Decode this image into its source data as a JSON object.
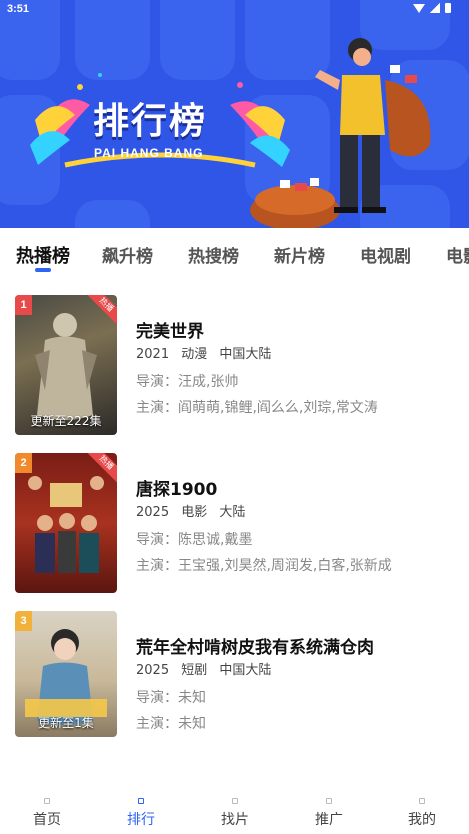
{
  "status_bar": {
    "time": "3:51"
  },
  "banner": {
    "title": "排行榜",
    "subtitle": "PAI HANG BANG"
  },
  "tabs": [
    {
      "label": "热播榜",
      "active": true
    },
    {
      "label": "飙升榜",
      "active": false
    },
    {
      "label": "热搜榜",
      "active": false
    },
    {
      "label": "新片榜",
      "active": false
    },
    {
      "label": "电视剧",
      "active": false
    },
    {
      "label": "电影",
      "active": false
    }
  ],
  "items": [
    {
      "rank": "1",
      "rank_color": "#e84a4a",
      "hot_badge": "热播",
      "update": "更新至222集",
      "title": "完美世界",
      "year": "2021",
      "genre": "动漫",
      "region": "中国大陆",
      "director": "导演：汪成,张帅",
      "cast": "主演：阎萌萌,锦鲤,阎么么,刘琮,常文涛"
    },
    {
      "rank": "2",
      "rank_color": "#f08a2c",
      "hot_badge": "热播",
      "update": "",
      "title": "唐探1900",
      "year": "2025",
      "genre": "电影",
      "region": "大陆",
      "director": "导演：陈思诚,戴墨",
      "cast": "主演：王宝强,刘昊然,周润发,白客,张新成"
    },
    {
      "rank": "3",
      "rank_color": "#f2b23a",
      "hot_badge": "",
      "update": "更新至1集",
      "title": "荒年全村啃树皮我有系统满仓肉",
      "year": "2025",
      "genre": "短剧",
      "region": "中国大陆",
      "director": "导演：未知",
      "cast": "主演：未知"
    }
  ],
  "bottom_nav": [
    {
      "label": "首页",
      "icon": "home-icon",
      "active": false
    },
    {
      "label": "排行",
      "icon": "ranking-icon",
      "active": true
    },
    {
      "label": "找片",
      "icon": "find-icon",
      "active": false
    },
    {
      "label": "推广",
      "icon": "promote-icon",
      "active": false
    },
    {
      "label": "我的",
      "icon": "profile-icon",
      "active": false
    }
  ],
  "colors": {
    "accent": "#2f64f2",
    "banner_bg": "#2f56e6"
  }
}
